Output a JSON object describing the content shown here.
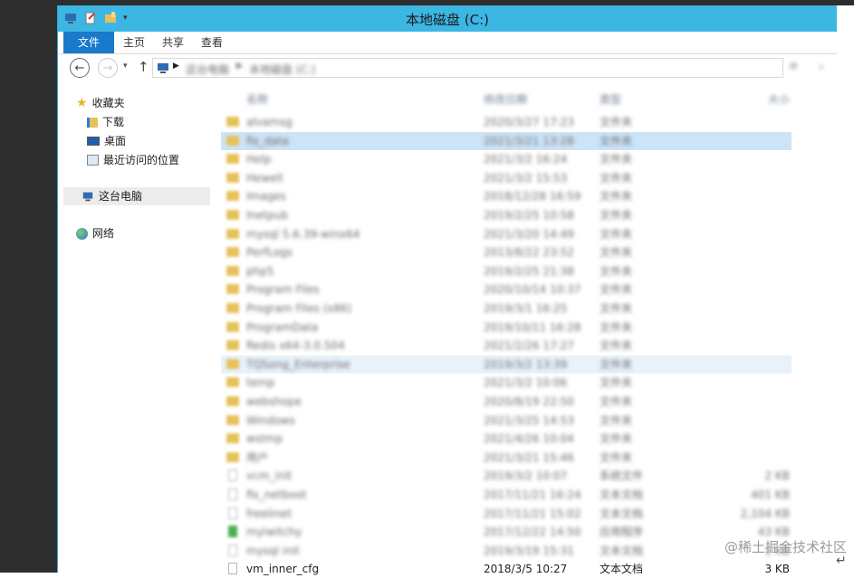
{
  "window": {
    "title": "本地磁盘 (C:)"
  },
  "ribbon": {
    "tabs": [
      "文件",
      "主页",
      "共享",
      "查看"
    ]
  },
  "address": {
    "breadcrumb": [
      "这台电脑",
      "本地磁盘 (C:)"
    ]
  },
  "nav": {
    "favorites": "收藏夹",
    "downloads": "下载",
    "desktop": "桌面",
    "recent": "最近访问的位置",
    "this_pc": "这台电脑",
    "network": "网络"
  },
  "columns": {
    "name": "名称",
    "date": "修改日期",
    "type": "类型",
    "size": "大小"
  },
  "files": [
    {
      "name": "alvamsg",
      "date": "2020/3/27 17:23",
      "type": "文件夹",
      "size": "",
      "kind": "folder"
    },
    {
      "name": "fis_data",
      "date": "2021/3/21 13:28",
      "type": "文件夹",
      "size": "",
      "kind": "folder",
      "state": "selected"
    },
    {
      "name": "Help",
      "date": "2021/3/2 16:24",
      "type": "文件夹",
      "size": "",
      "kind": "folder"
    },
    {
      "name": "Hewell",
      "date": "2021/3/2 15:53",
      "type": "文件夹",
      "size": "",
      "kind": "folder"
    },
    {
      "name": "Images",
      "date": "2018/12/28 16:59",
      "type": "文件夹",
      "size": "",
      "kind": "folder"
    },
    {
      "name": "Inetpub",
      "date": "2019/2/25 10:58",
      "type": "文件夹",
      "size": "",
      "kind": "folder"
    },
    {
      "name": "mysql 5.6.39-winx64",
      "date": "2021/3/20 14:49",
      "type": "文件夹",
      "size": "",
      "kind": "folder"
    },
    {
      "name": "PerfLogs",
      "date": "2013/8/22 23:52",
      "type": "文件夹",
      "size": "",
      "kind": "folder"
    },
    {
      "name": "php5",
      "date": "2019/2/25 21:38",
      "type": "文件夹",
      "size": "",
      "kind": "folder"
    },
    {
      "name": "Program Files",
      "date": "2020/10/14 10:37",
      "type": "文件夹",
      "size": "",
      "kind": "folder"
    },
    {
      "name": "Program Files (x86)",
      "date": "2019/3/1 16:25",
      "type": "文件夹",
      "size": "",
      "kind": "folder"
    },
    {
      "name": "ProgramData",
      "date": "2019/10/11 16:28",
      "type": "文件夹",
      "size": "",
      "kind": "folder"
    },
    {
      "name": "Redis x64-3.0.504",
      "date": "2021/2/26 17:27",
      "type": "文件夹",
      "size": "",
      "kind": "folder"
    },
    {
      "name": "TQSong_Enterprise",
      "date": "2019/3/2 13:39",
      "type": "文件夹",
      "size": "",
      "kind": "folder",
      "state": "hover"
    },
    {
      "name": "temp",
      "date": "2021/3/2 10:06",
      "type": "文件夹",
      "size": "",
      "kind": "folder"
    },
    {
      "name": "webshope",
      "date": "2020/8/19 22:50",
      "type": "文件夹",
      "size": "",
      "kind": "folder"
    },
    {
      "name": "Windows",
      "date": "2021/3/25 14:53",
      "type": "文件夹",
      "size": "",
      "kind": "folder"
    },
    {
      "name": "wstmp",
      "date": "2021/4/26 10:04",
      "type": "文件夹",
      "size": "",
      "kind": "folder"
    },
    {
      "name": "用户",
      "date": "2021/3/21 15:46",
      "type": "文件夹",
      "size": "",
      "kind": "folder"
    },
    {
      "name": "vcm_init",
      "date": "2019/3/2 10:07",
      "type": "系统文件",
      "size": "2 KB",
      "kind": "doc"
    },
    {
      "name": "fis_netboot",
      "date": "2017/11/21 16:24",
      "type": "文本文档",
      "size": "401 KB",
      "kind": "doc"
    },
    {
      "name": "freelinet",
      "date": "2017/11/21 15:02",
      "type": "文本文档",
      "size": "2,104 KB",
      "kind": "doc"
    },
    {
      "name": "myiwitchy",
      "date": "2017/12/22 14:50",
      "type": "应用程序",
      "size": "43 KB",
      "kind": "app"
    },
    {
      "name": "mysql init",
      "date": "2019/3/19 15:31",
      "type": "文本文档",
      "size": "1 KB",
      "kind": "doc"
    },
    {
      "name": "vm_inner_cfg",
      "date": "2018/3/5 10:27",
      "type": "文本文档",
      "size": "3 KB",
      "kind": "doc"
    }
  ],
  "watermark": "@稀土掘金技术社区",
  "cursor_glyph": "↵"
}
